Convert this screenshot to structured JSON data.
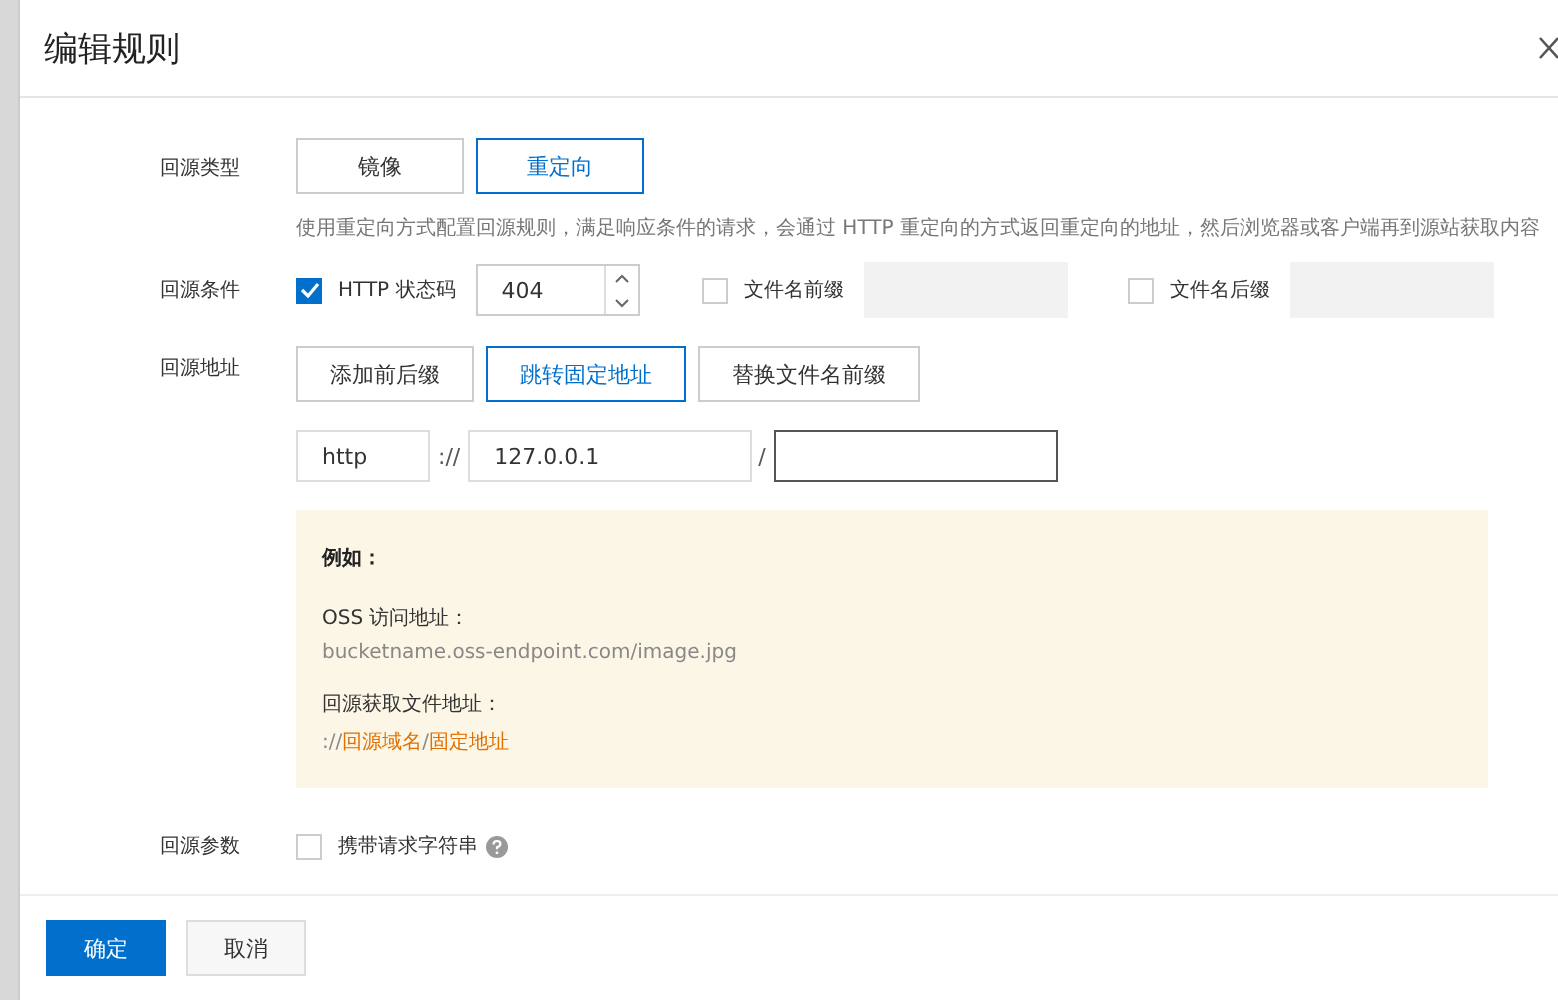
{
  "dialog": {
    "title": "编辑规则"
  },
  "source_type": {
    "label": "回源类型",
    "options": [
      {
        "label": "镜像",
        "selected": false
      },
      {
        "label": "重定向",
        "selected": true
      }
    ],
    "hint": "使用重定向方式配置回源规则，满足响应条件的请求，会通过 HTTP 重定向的方式返回重定向的地址，然后浏览器或客户端再到源站获取内容"
  },
  "condition": {
    "label": "回源条件",
    "items": [
      {
        "kind": "number",
        "label": "HTTP 状态码",
        "checked": true,
        "value": "404"
      },
      {
        "kind": "text",
        "label": "文件名前缀",
        "checked": false,
        "disabled": true
      },
      {
        "kind": "text",
        "label": "文件名后缀",
        "checked": false,
        "disabled": true
      }
    ]
  },
  "address": {
    "label": "回源地址",
    "options": [
      {
        "label": "添加前后缀",
        "selected": false
      },
      {
        "label": "跳转固定地址",
        "selected": true
      },
      {
        "label": "替换文件名前缀",
        "selected": false
      }
    ],
    "protocol": "http",
    "separator_1": "://",
    "host": "127.0.0.1",
    "separator_2": "/"
  },
  "example": {
    "title": "例如：",
    "oss_label": "OSS 访问地址：",
    "oss_value": "bucketname.oss-endpoint.com/image.jpg",
    "source_label": "回源获取文件地址：",
    "source_value": [
      {
        "kind": "plain",
        "text": "://"
      },
      {
        "kind": "highlight",
        "text": "回源域名"
      },
      {
        "kind": "plain",
        "text": "/"
      },
      {
        "kind": "highlight",
        "text": "固定地址"
      }
    ]
  },
  "params": {
    "label": "回源参数",
    "option": {
      "label": "携带请求字符串",
      "checked": false
    }
  },
  "buttons": [
    {
      "kind": "primary",
      "label": "确定"
    },
    {
      "kind": "default",
      "label": "取消"
    }
  ]
}
